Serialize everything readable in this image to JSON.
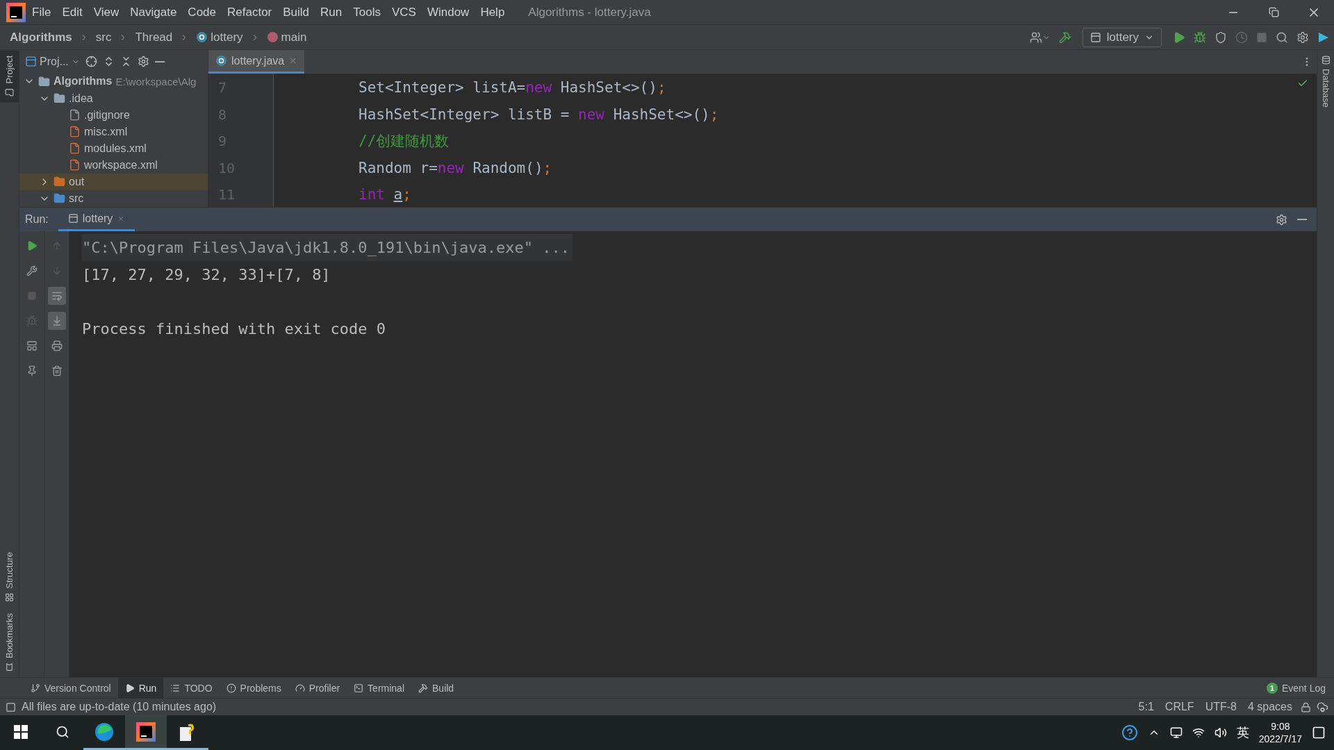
{
  "menu": [
    "File",
    "Edit",
    "View",
    "Navigate",
    "Code",
    "Refactor",
    "Build",
    "Run",
    "Tools",
    "VCS",
    "Window",
    "Help"
  ],
  "window_title": "Algorithms - lottery.java",
  "breadcrumb": [
    {
      "label": "Algorithms",
      "kind": "project"
    },
    {
      "label": "src",
      "kind": "folder"
    },
    {
      "label": "Thread",
      "kind": "folder"
    },
    {
      "label": "lottery",
      "kind": "class"
    },
    {
      "label": "main",
      "kind": "method"
    }
  ],
  "run_config": "lottery",
  "left_strip": [
    {
      "label": "Project",
      "selected": true
    },
    {
      "label": "Structure",
      "selected": false
    },
    {
      "label": "Bookmarks",
      "selected": false
    }
  ],
  "right_strip": [
    {
      "label": "Database",
      "selected": false
    }
  ],
  "project_panel": {
    "title": "Proj...",
    "tree": [
      {
        "label": "Algorithms",
        "path": "E:\\workspace\\Alg",
        "kind": "module",
        "expanded": true,
        "selected": false,
        "children": [
          {
            "label": ".idea",
            "kind": "folder",
            "expanded": true,
            "selected": false,
            "children": [
              {
                "label": ".gitignore",
                "kind": "ignore",
                "selected": false
              },
              {
                "label": "misc.xml",
                "kind": "xml",
                "selected": false
              },
              {
                "label": "modules.xml",
                "kind": "xml",
                "selected": false
              },
              {
                "label": "workspace.xml",
                "kind": "xml",
                "selected": false
              }
            ]
          },
          {
            "label": "out",
            "kind": "excluded",
            "expanded": false,
            "selected": true
          },
          {
            "label": "src",
            "kind": "source",
            "expanded": true,
            "selected": false
          }
        ]
      }
    ]
  },
  "editor_tabs": [
    {
      "label": "lottery.java",
      "selected": true
    }
  ],
  "code": [
    {
      "number": "7",
      "tokens": [
        {
          "text": "Set<Integer> listA=",
          "kind": "plain"
        },
        {
          "text": "new",
          "kind": "keyword"
        },
        {
          "text": " HashSet<>()",
          "kind": "plain"
        },
        {
          "text": ";",
          "kind": "punct"
        }
      ]
    },
    {
      "number": "8",
      "tokens": [
        {
          "text": "HashSet<Integer> listB = ",
          "kind": "plain"
        },
        {
          "text": "new",
          "kind": "keyword"
        },
        {
          "text": " HashSet<>()",
          "kind": "plain"
        },
        {
          "text": ";",
          "kind": "punct"
        }
      ]
    },
    {
      "number": "9",
      "tokens": [
        {
          "text": "//创建随机数",
          "kind": "comment"
        }
      ]
    },
    {
      "number": "10",
      "tokens": [
        {
          "text": "Random r=",
          "kind": "plain"
        },
        {
          "text": "new",
          "kind": "keyword"
        },
        {
          "text": " Random()",
          "kind": "plain"
        },
        {
          "text": ";",
          "kind": "punct"
        }
      ]
    },
    {
      "number": "11",
      "tokens": [
        {
          "text": "int ",
          "kind": "keyword"
        },
        {
          "text": "a",
          "kind": "unused"
        },
        {
          "text": ";",
          "kind": "punct"
        }
      ]
    }
  ],
  "run_panel": {
    "label": "Run:",
    "tabs": [
      {
        "label": "lottery",
        "selected": true
      }
    ],
    "soft_wrap": true,
    "scroll_to_end": true,
    "console": [
      {
        "text": "\"C:\\Program Files\\Java\\jdk1.8.0_191\\bin\\java.exe\" ...",
        "kind": "command"
      },
      {
        "text": "[17, 27, 29, 32, 33]+[7, 8]",
        "kind": "output"
      },
      {
        "kind": "blank"
      },
      {
        "text": "Process finished with exit code 0",
        "kind": "output"
      }
    ]
  },
  "tool_tabs": [
    {
      "label": "Version Control",
      "kind": "vcs",
      "selected": false
    },
    {
      "label": "Run",
      "kind": "run",
      "selected": true
    },
    {
      "label": "TODO",
      "kind": "todo",
      "selected": false
    },
    {
      "label": "Problems",
      "kind": "problems",
      "selected": false
    },
    {
      "label": "Profiler",
      "kind": "profiler",
      "selected": false
    },
    {
      "label": "Terminal",
      "kind": "terminal",
      "selected": false
    },
    {
      "label": "Build",
      "kind": "build",
      "selected": false
    }
  ],
  "event_log": {
    "count": "1",
    "label": "Event Log"
  },
  "status_bar": {
    "message": "All files are up-to-date (10 minutes ago)",
    "items": [
      "5:1",
      "CRLF",
      "UTF-8",
      "4 spaces"
    ]
  },
  "taskbar": {
    "apps": [
      {
        "kind": "edge",
        "selected": false
      },
      {
        "kind": "intellij",
        "selected": true
      },
      {
        "kind": "notes",
        "selected": false
      }
    ],
    "ime": "英",
    "time": "9:08",
    "date": "2022/7/17"
  }
}
